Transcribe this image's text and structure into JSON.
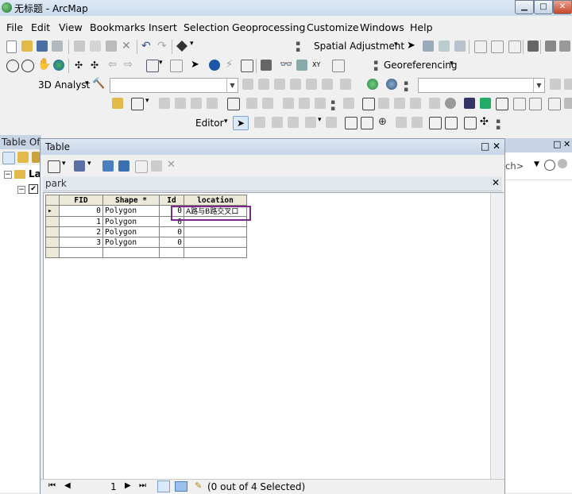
{
  "title": "无标题 - ArcMap",
  "window_buttons": {
    "minimize": "▁",
    "maximize": "□",
    "close": "✕"
  },
  "menu": [
    "File",
    "Edit",
    "View",
    "Bookmarks",
    "Insert",
    "Selection",
    "Geoprocessing",
    "Customize",
    "Windows",
    "Help"
  ],
  "toolbars": {
    "spatial_adjustment": "Spatial Adjustment",
    "georeferencing": "Georeferencing",
    "analyst_3d": "3D Analyst",
    "editor": "Editor"
  },
  "toc": {
    "title": "Table Of",
    "layer_label": "La"
  },
  "table_window": {
    "title": "Table",
    "tab_name": "park",
    "columns": [
      "FID",
      "Shape *",
      "Id",
      "location"
    ],
    "rows": [
      [
        "0",
        "Polygon",
        "0",
        "A路与B路交叉口"
      ],
      [
        "1",
        "Polygon",
        "0",
        ""
      ],
      [
        "2",
        "Polygon",
        "0",
        ""
      ],
      [
        "3",
        "Polygon",
        "0",
        ""
      ]
    ],
    "record_number": "1",
    "selection_status": "(0 out of 4 Selected)"
  },
  "right_dock": {
    "search_text": "ch>"
  },
  "colors": {
    "highlight_border": "#7b2a8c",
    "titlebar": "#c9dbee"
  }
}
